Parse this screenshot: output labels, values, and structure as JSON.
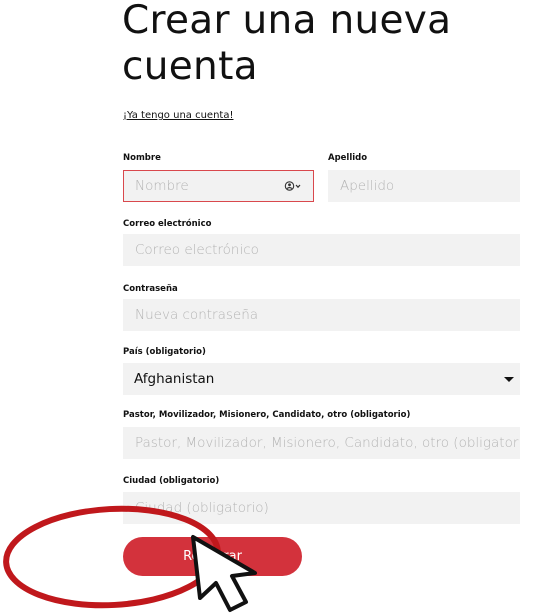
{
  "form": {
    "title": "Crear una nueva cuenta",
    "login_link": "¡Ya tengo una cuenta!",
    "fields": {
      "first_name": {
        "label": "Nombre",
        "placeholder": "Nombre",
        "value": ""
      },
      "last_name": {
        "label": "Apellido",
        "placeholder": "Apellido",
        "value": ""
      },
      "email": {
        "label": "Correo electrónico",
        "placeholder": "Correo electrónico",
        "value": ""
      },
      "password": {
        "label": "Contraseña",
        "placeholder": "Nueva contraseña",
        "value": ""
      },
      "country": {
        "label": "País (obligatorio)",
        "selected": "Afghanistan"
      },
      "role": {
        "label": "Pastor, Movilizador, Misionero, Candidato, otro (obligatorio)",
        "placeholder": "Pastor, Movilizador, Misionero, Candidato, otro (obligatorio)",
        "value": ""
      },
      "city": {
        "label": "Ciudad (obligatorio)",
        "placeholder": "Ciudad (obligatorio)",
        "value": ""
      }
    },
    "submit_label": "Registrar"
  },
  "colors": {
    "accent": "#d3323c",
    "error_border": "#d9484d",
    "field_background": "#f2f2f2",
    "annotation_ellipse": "#c0181c"
  },
  "icons": {
    "autofill": "autofill-contact-icon",
    "select_caret": "caret-down-icon",
    "cursor": "mouse-pointer-icon",
    "annotation": "highlight-ellipse"
  }
}
